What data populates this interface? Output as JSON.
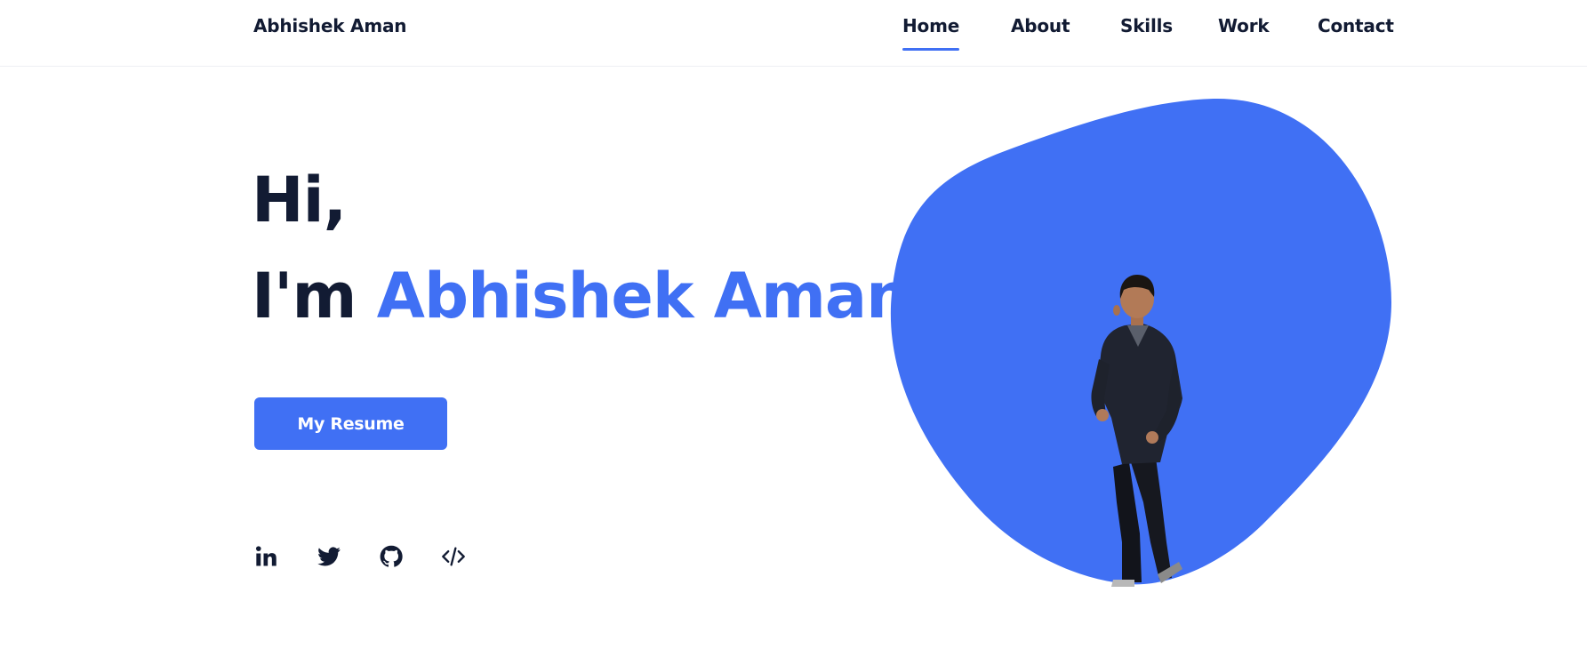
{
  "header": {
    "brand": "Abhishek Aman",
    "nav": [
      {
        "label": "Home",
        "active": true
      },
      {
        "label": "About",
        "active": false
      },
      {
        "label": "Skills",
        "active": false
      },
      {
        "label": "Work",
        "active": false
      },
      {
        "label": "Contact",
        "active": false
      }
    ]
  },
  "hero": {
    "greeting": "Hi,",
    "intro": "I'm",
    "name": "Abhishek Aman",
    "resume_button": "My Resume"
  },
  "social": [
    {
      "icon": "linkedin-icon"
    },
    {
      "icon": "twitter-icon"
    },
    {
      "icon": "github-icon"
    },
    {
      "icon": "code-icon"
    }
  ],
  "colors": {
    "accent": "#4070f4",
    "text": "#121b33",
    "background": "#ffffff"
  }
}
